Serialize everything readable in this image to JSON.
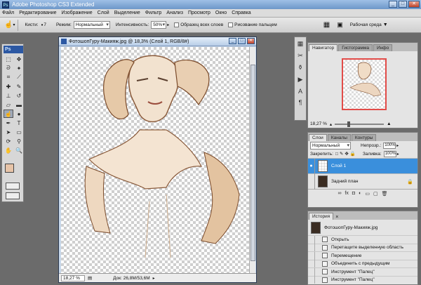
{
  "app": {
    "title": "Adobe Photoshop CS3 Extended"
  },
  "colors": {
    "selection": "#3a8fdc",
    "nav_frame": "#e24b48",
    "fg_swatch": "#e7c4a8",
    "bg_swatch": "#111111"
  },
  "menu": [
    "Файл",
    "Редактирование",
    "Изображение",
    "Слой",
    "Выделение",
    "Фильтр",
    "Анализ",
    "Просмотр",
    "Окно",
    "Справка"
  ],
  "options": {
    "brushes_label": "Кисти:",
    "brush_size": "7",
    "mode_label": "Режим:",
    "mode_value": "Нормальный",
    "intensity_label": "Интенсивность:",
    "intensity_value": "50%",
    "sample_all_label": "Образец всех слоев",
    "finger_paint_label": "Рисование пальцем",
    "workspace_label": "Рабочая среда"
  },
  "document": {
    "title": "ФотошопГуру-Макияж.jpg @ 18,3% (Слой 1, RGB/8#)",
    "zoom": "18,27 %",
    "doc_size": "Док: 26,8М/53,6М"
  },
  "navigator": {
    "tabs": [
      "Навигатор",
      "Гистограмма",
      "Инфо"
    ],
    "zoom": "18,27 %"
  },
  "layers": {
    "tabs": [
      "Слои",
      "Каналы",
      "Контуры"
    ],
    "blend_mode": "Нормальный",
    "opacity_label": "Непрозр.:",
    "opacity": "100%",
    "lock_label": "Закрепить:",
    "fill_label": "Заливка:",
    "fill": "100%",
    "items": [
      {
        "name": "Слой 1"
      },
      {
        "name": "Задний план"
      }
    ]
  },
  "history": {
    "tab": "История",
    "snapshot": "ФотошопГуру-Макияж.jpg",
    "steps": [
      "Открыть",
      "Перетащите выделенную область",
      "Перемещение",
      "Объединить с предыдущим",
      "Инструмент \"Палец\"",
      "Инструмент \"Палец\""
    ]
  }
}
